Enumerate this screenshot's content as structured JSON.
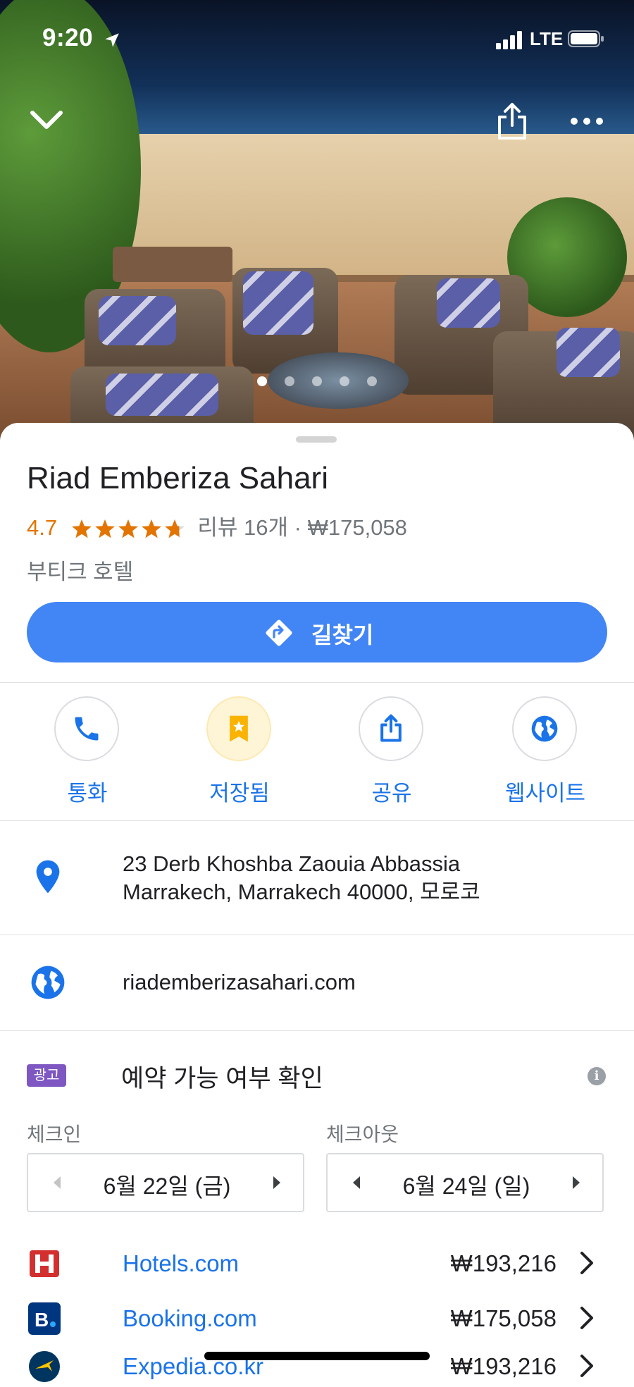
{
  "status_bar": {
    "time": "9:20",
    "network": "LTE"
  },
  "place": {
    "name": "Riad Emberiza Sahari",
    "rating": "4.7",
    "rating_value": 4.7,
    "reviews": "리뷰 16개",
    "price_separator": "·",
    "price": "₩175,058",
    "category": "부티크 호텔"
  },
  "directions_label": "길찾기",
  "photo_dots": {
    "count": 5,
    "active_index": 0
  },
  "actions": [
    {
      "label": "통화",
      "icon": "phone-icon"
    },
    {
      "label": "저장됨",
      "icon": "bookmark-star-icon"
    },
    {
      "label": "공유",
      "icon": "share-icon"
    },
    {
      "label": "웹사이트",
      "icon": "globe-icon"
    }
  ],
  "address": {
    "line1": "23 Derb Khoshba Zaouia Abbassia",
    "line2": "Marrakech, Marrakech 40000, 모로코"
  },
  "website": "riademberizasahari.com",
  "availability": {
    "ad_badge": "광고",
    "title": "예약 가능 여부 확인",
    "checkin_label": "체크인",
    "checkout_label": "체크아웃",
    "checkin_date": "6월 22일 (금)",
    "checkout_date": "6월 24일 (일)"
  },
  "providers": [
    {
      "name": "Hotels.com",
      "price": "₩193,216",
      "color": "#d32f2f"
    },
    {
      "name": "Booking.com",
      "price": "₩175,058",
      "color": "#003580"
    },
    {
      "name": "Expedia.co.kr",
      "price": "₩193,216",
      "color": "#00355f"
    }
  ],
  "colors": {
    "accent": "#4285f4",
    "link": "#1a73e8",
    "rating": "#e37400",
    "ad": "#7e57c2"
  }
}
